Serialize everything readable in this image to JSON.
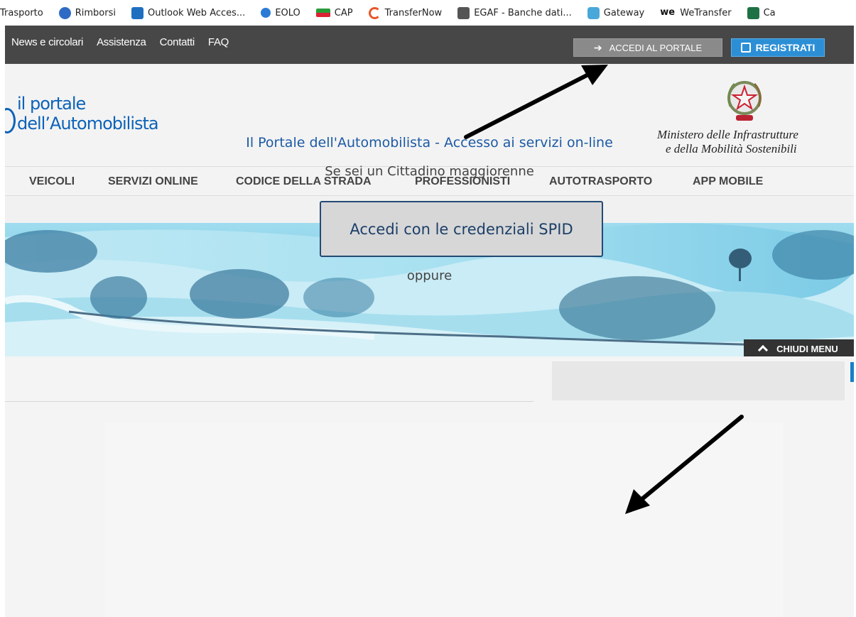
{
  "bookmarks": [
    {
      "label": "Trasporto",
      "icon": "none"
    },
    {
      "label": "Rimborsi",
      "icon": "rimborsi-icon"
    },
    {
      "label": "Outlook Web Acces...",
      "icon": "outlook-icon"
    },
    {
      "label": "EOLO",
      "icon": "ie-icon"
    },
    {
      "label": "CAP",
      "icon": "cap-icon"
    },
    {
      "label": "TransferNow",
      "icon": "transfernow-icon"
    },
    {
      "label": "EGAF - Banche dati...",
      "icon": "egaf-icon"
    },
    {
      "label": "Gateway",
      "icon": "gateway-icon"
    },
    {
      "label": "WeTransfer",
      "icon": "wetransfer-icon"
    },
    {
      "label": "Ca",
      "icon": "excel-icon"
    }
  ],
  "topbar": {
    "links": [
      "News e circolari",
      "Assistenza",
      "Contatti",
      "FAQ"
    ],
    "login_label": "ACCEDI AL PORTALE",
    "register_label": "REGISTRATI"
  },
  "header": {
    "logo_line1": "il portale",
    "logo_line2": "dell’Automobilista",
    "ministry_line1": "Ministero delle Infrastrutture",
    "ministry_line2": "e della Mobilità Sostenibili"
  },
  "main_nav": [
    "VEICOLI",
    "SERVIZI ONLINE",
    "CODICE DELLA STRADA",
    "PROFESSIONISTI",
    "AUTOTRASPORTO",
    "APP MOBILE"
  ],
  "hero": {
    "close_menu_label": "CHIUDI MENU"
  },
  "login_panel": {
    "title": "Il Portale dell'Automobilista - Accesso ai servizi on-line",
    "subtitle": "Se sei un Cittadino maggiorenne",
    "spid_button": "Accedi con le credenziali SPID",
    "or_text": "oppure"
  },
  "colors": {
    "brand_blue": "#0d63b8",
    "topbar_bg": "#474747",
    "register_blue": "#2c8fd6",
    "spid_border": "#234a74"
  }
}
